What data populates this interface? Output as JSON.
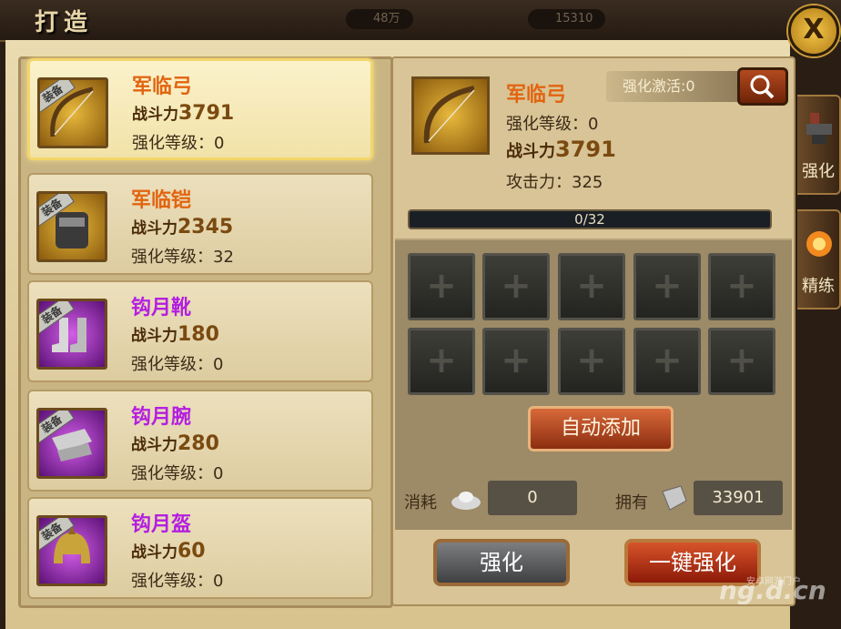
{
  "window": {
    "title": "打造",
    "close_label": "X"
  },
  "currency": {
    "silver": "48万",
    "gold": "15310"
  },
  "equipment_list": [
    {
      "tag": "装备",
      "name": "军临弓",
      "power_label": "战斗力",
      "power": "3791",
      "level_label": "强化等级：",
      "level": "0",
      "quality": "orange",
      "selected": true
    },
    {
      "tag": "装备",
      "name": "军临铠",
      "power_label": "战斗力",
      "power": "2345",
      "level_label": "强化等级：",
      "level": "32",
      "quality": "orange",
      "selected": false
    },
    {
      "tag": "装备",
      "name": "钩月靴",
      "power_label": "战斗力",
      "power": "180",
      "level_label": "强化等级：",
      "level": "0",
      "quality": "purple",
      "selected": false
    },
    {
      "tag": "装备",
      "name": "钩月腕",
      "power_label": "战斗力",
      "power": "280",
      "level_label": "强化等级：",
      "level": "0",
      "quality": "purple",
      "selected": false
    },
    {
      "tag": "装备",
      "name": "钩月盔",
      "power_label": "战斗力",
      "power": "60",
      "level_label": "强化等级：",
      "level": "0",
      "quality": "purple",
      "selected": false
    }
  ],
  "detail": {
    "name": "军临弓",
    "level_text": "强化等级：0",
    "power_label": "战斗力",
    "power": "3791",
    "attack_text": "攻击力：325",
    "activation_text": "强化激活:0",
    "progress_text": "0/32",
    "progress_fraction": 0.0
  },
  "slots_plus": "+",
  "auto_add_label": "自动添加",
  "cost": {
    "label": "消耗",
    "value": "0"
  },
  "owned": {
    "label": "拥有",
    "value": "33901"
  },
  "buttons": {
    "enhance": "强化",
    "one_click": "一键强化"
  },
  "side_tabs": [
    {
      "label": "强化"
    },
    {
      "label": "精练"
    }
  ],
  "watermark": {
    "main": "ng.d.cn",
    "small": "安卓网游门户"
  },
  "colors": {
    "orange_name": "#e26410",
    "purple_name": "#b41ee0",
    "power": "#7a4a10"
  }
}
